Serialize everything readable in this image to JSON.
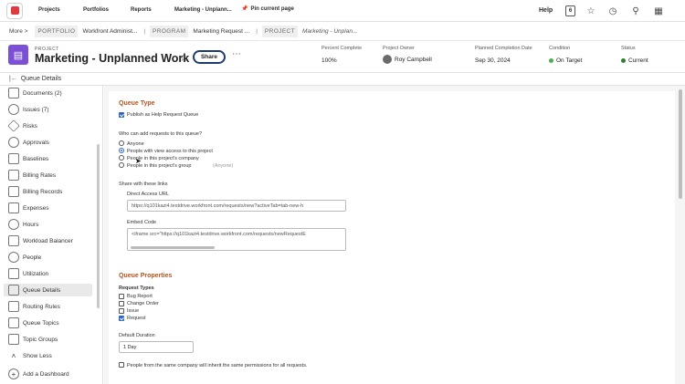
{
  "nav": {
    "projects": "Projects",
    "portfolios": "Portfolios",
    "reports": "Reports",
    "recent": "Marketing - Unplann...",
    "pin": "Pin current page",
    "help": "Help",
    "badge": "6"
  },
  "breadcrumb": {
    "more": "More >",
    "portfolio_tag": "PORTFOLIO",
    "portfolio_val": "Workfront Administ...",
    "program_tag": "PROGRAM",
    "program_val": "Marketing Request ...",
    "project_tag": "PROJECT",
    "project_val": "Marketing - Unplan..."
  },
  "project": {
    "label": "PROJECT",
    "title": "Marketing - Unplanned Work",
    "share": "Share",
    "fields": {
      "percent_label": "Percent Complete",
      "percent_value": "100%",
      "owner_label": "Project Owner",
      "owner_value": "Roy Campbell",
      "date_label": "Planned Completion Date",
      "date_value": "Sep 30, 2024",
      "condition_label": "Condition",
      "condition_value": "On Target",
      "status_label": "Status",
      "status_value": "Current"
    }
  },
  "colors": {
    "on_target": "#4caf50",
    "current": "#2e7d32",
    "accent": "#b3551f",
    "project_icon": "#7b4fd6"
  },
  "section_title": "Queue Details",
  "sidebar": {
    "items": [
      {
        "label": "Documents (2)",
        "icon": "document-icon"
      },
      {
        "label": "Issues (7)",
        "icon": "issue-icon"
      },
      {
        "label": "Risks",
        "icon": "risk-icon"
      },
      {
        "label": "Approvals",
        "icon": "approval-icon"
      },
      {
        "label": "Baselines",
        "icon": "baseline-icon"
      },
      {
        "label": "Billing Rates",
        "icon": "billing-rates-icon"
      },
      {
        "label": "Billing Records",
        "icon": "billing-records-icon"
      },
      {
        "label": "Expenses",
        "icon": "expense-icon"
      },
      {
        "label": "Hours",
        "icon": "clock-icon"
      },
      {
        "label": "Workload Balancer",
        "icon": "workload-icon"
      },
      {
        "label": "People",
        "icon": "people-icon"
      },
      {
        "label": "Utilization",
        "icon": "utilization-icon"
      },
      {
        "label": "Queue Details",
        "icon": "queue-icon"
      },
      {
        "label": "Routing Rules",
        "icon": "routing-icon"
      },
      {
        "label": "Queue Topics",
        "icon": "topics-icon"
      },
      {
        "label": "Topic Groups",
        "icon": "topic-groups-icon"
      },
      {
        "label": "Show Less",
        "icon": "chevron-up-icon"
      },
      {
        "label": "Add a Dashboard",
        "icon": "plus-icon"
      }
    ]
  },
  "queue": {
    "type_title": "Queue Type",
    "publish_label": "Publish as Help Request Queue",
    "who_label": "Who can add requests to this queue?",
    "options": [
      "Anyone",
      "People with view access to this project",
      "People in this project's company",
      "People in this project's group"
    ],
    "group_hint": "(Anyone)",
    "share_label": "Share with these links",
    "direct_label": "Direct Access URL",
    "direct_value": "https://q101kazi4.testdrive.workfront.com/requests/new?activeTab=tab-new-h",
    "embed_label": "Embed Code",
    "embed_value": "<iframe src=\"https://q101kazi4.testdrive.workfront.com/requests/newRequestE",
    "props_title": "Queue Properties",
    "request_types_label": "Request Types",
    "request_types": [
      "Bug Report",
      "Change Order",
      "Issue",
      "Request"
    ],
    "duration_label": "Default Duration",
    "duration_value": "1 Day",
    "same_company_label": "People from the same company will inherit the same permissions for all requests."
  }
}
